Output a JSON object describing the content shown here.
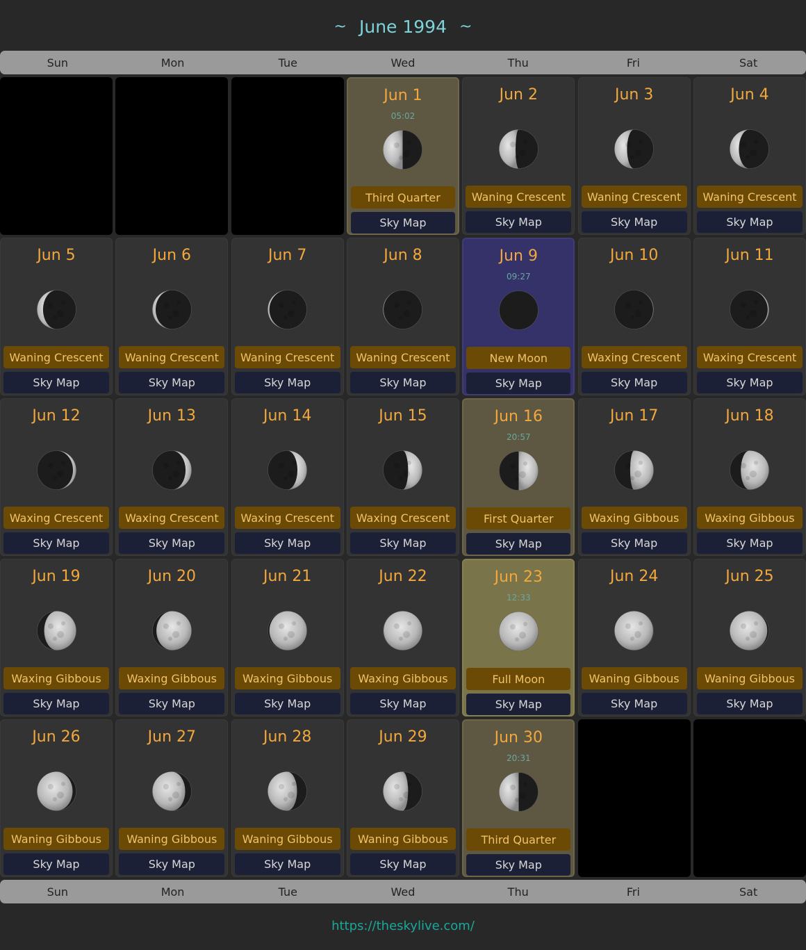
{
  "calendar": {
    "title": "June 1994",
    "title_decoration": "~",
    "weekdays": [
      "Sun",
      "Mon",
      "Tue",
      "Wed",
      "Thu",
      "Fri",
      "Sat"
    ],
    "sky_map_label": "Sky Map",
    "leading_empty_days": 3,
    "trailing_empty_days": 2,
    "days": [
      {
        "date": "Jun 1",
        "time": "05:02",
        "phase": "Third Quarter",
        "illumination": 0.5,
        "waxing": false,
        "highlight": "quarter"
      },
      {
        "date": "Jun 2",
        "time": "",
        "phase": "Waning Crescent",
        "illumination": 0.42,
        "waxing": false,
        "highlight": ""
      },
      {
        "date": "Jun 3",
        "time": "",
        "phase": "Waning Crescent",
        "illumination": 0.32,
        "waxing": false,
        "highlight": ""
      },
      {
        "date": "Jun 4",
        "time": "",
        "phase": "Waning Crescent",
        "illumination": 0.23,
        "waxing": false,
        "highlight": ""
      },
      {
        "date": "Jun 5",
        "time": "",
        "phase": "Waning Crescent",
        "illumination": 0.15,
        "waxing": false,
        "highlight": ""
      },
      {
        "date": "Jun 6",
        "time": "",
        "phase": "Waning Crescent",
        "illumination": 0.08,
        "waxing": false,
        "highlight": ""
      },
      {
        "date": "Jun 7",
        "time": "",
        "phase": "Waning Crescent",
        "illumination": 0.04,
        "waxing": false,
        "highlight": ""
      },
      {
        "date": "Jun 8",
        "time": "",
        "phase": "Waning Crescent",
        "illumination": 0.01,
        "waxing": false,
        "highlight": ""
      },
      {
        "date": "Jun 9",
        "time": "09:27",
        "phase": "New Moon",
        "illumination": 0.0,
        "waxing": true,
        "highlight": "newmoon"
      },
      {
        "date": "Jun 10",
        "time": "",
        "phase": "Waxing Crescent",
        "illumination": 0.01,
        "waxing": true,
        "highlight": ""
      },
      {
        "date": "Jun 11",
        "time": "",
        "phase": "Waxing Crescent",
        "illumination": 0.03,
        "waxing": true,
        "highlight": ""
      },
      {
        "date": "Jun 12",
        "time": "",
        "phase": "Waxing Crescent",
        "illumination": 0.08,
        "waxing": true,
        "highlight": ""
      },
      {
        "date": "Jun 13",
        "time": "",
        "phase": "Waxing Crescent",
        "illumination": 0.15,
        "waxing": true,
        "highlight": ""
      },
      {
        "date": "Jun 14",
        "time": "",
        "phase": "Waxing Crescent",
        "illumination": 0.24,
        "waxing": true,
        "highlight": ""
      },
      {
        "date": "Jun 15",
        "time": "",
        "phase": "Waxing Crescent",
        "illumination": 0.36,
        "waxing": true,
        "highlight": ""
      },
      {
        "date": "Jun 16",
        "time": "20:57",
        "phase": "First Quarter",
        "illumination": 0.5,
        "waxing": true,
        "highlight": "quarter"
      },
      {
        "date": "Jun 17",
        "time": "",
        "phase": "Waxing Gibbous",
        "illumination": 0.6,
        "waxing": true,
        "highlight": ""
      },
      {
        "date": "Jun 18",
        "time": "",
        "phase": "Waxing Gibbous",
        "illumination": 0.72,
        "waxing": true,
        "highlight": ""
      },
      {
        "date": "Jun 19",
        "time": "",
        "phase": "Waxing Gibbous",
        "illumination": 0.82,
        "waxing": true,
        "highlight": ""
      },
      {
        "date": "Jun 20",
        "time": "",
        "phase": "Waxing Gibbous",
        "illumination": 0.9,
        "waxing": true,
        "highlight": ""
      },
      {
        "date": "Jun 21",
        "time": "",
        "phase": "Waxing Gibbous",
        "illumination": 0.96,
        "waxing": true,
        "highlight": ""
      },
      {
        "date": "Jun 22",
        "time": "",
        "phase": "Waxing Gibbous",
        "illumination": 0.99,
        "waxing": true,
        "highlight": ""
      },
      {
        "date": "Jun 23",
        "time": "12:33",
        "phase": "Full Moon",
        "illumination": 1.0,
        "waxing": false,
        "highlight": "fullmoon"
      },
      {
        "date": "Jun 24",
        "time": "",
        "phase": "Waning Gibbous",
        "illumination": 0.99,
        "waxing": false,
        "highlight": ""
      },
      {
        "date": "Jun 25",
        "time": "",
        "phase": "Waning Gibbous",
        "illumination": 0.96,
        "waxing": false,
        "highlight": ""
      },
      {
        "date": "Jun 26",
        "time": "",
        "phase": "Waning Gibbous",
        "illumination": 0.91,
        "waxing": false,
        "highlight": ""
      },
      {
        "date": "Jun 27",
        "time": "",
        "phase": "Waning Gibbous",
        "illumination": 0.84,
        "waxing": false,
        "highlight": ""
      },
      {
        "date": "Jun 28",
        "time": "",
        "phase": "Waning Gibbous",
        "illumination": 0.75,
        "waxing": false,
        "highlight": ""
      },
      {
        "date": "Jun 29",
        "time": "",
        "phase": "Waning Gibbous",
        "illumination": 0.64,
        "waxing": false,
        "highlight": ""
      },
      {
        "date": "Jun 30",
        "time": "20:31",
        "phase": "Third Quarter",
        "illumination": 0.5,
        "waxing": false,
        "highlight": "quarter"
      }
    ]
  },
  "footer": {
    "link_text": "https://theskylive.com/"
  },
  "colors": {
    "page_bg": "#282828",
    "accent_date": "#f2a83c",
    "title": "#7dd3d8",
    "phase_bg": "#6b4a05",
    "skymap_bg": "#1c2036",
    "link": "#1aa89a"
  }
}
